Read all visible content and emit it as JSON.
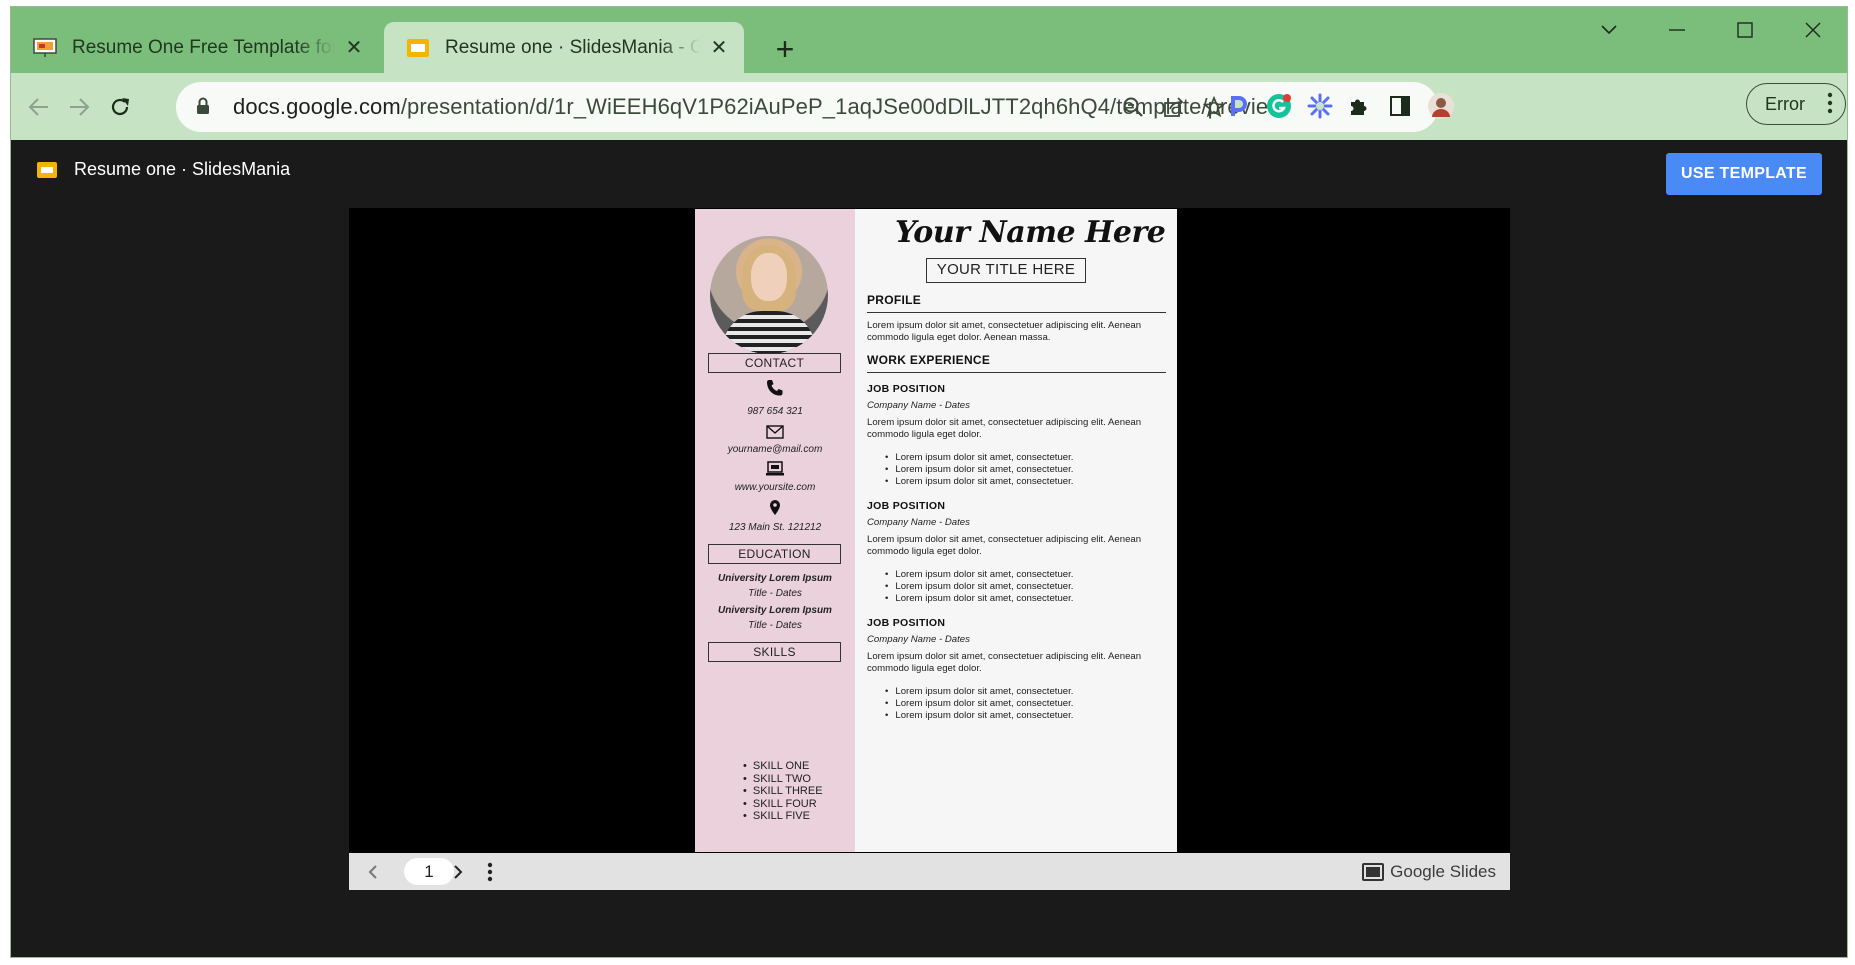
{
  "browser": {
    "tabs": [
      {
        "title": "Resume One Free Template for Google Slides",
        "active": false
      },
      {
        "title": "Resume one · SlidesMania - Google Slides",
        "active": true
      }
    ],
    "url_host": "docs.google.com",
    "url_path": "/presentation/d/1r_WiEEH6qV1P62iAuPeP_1aqJSe00dDlLJTT2qh6hQ4/template/preview",
    "profile_status": "Error"
  },
  "app": {
    "doc_title": "Resume one · SlidesMania",
    "use_template_label": "USE TEMPLATE",
    "current_page": "1",
    "footer_brand": "Google Slides"
  },
  "resume": {
    "name": "Your Name Here",
    "title": "YOUR TITLE HERE",
    "contact_header": "CONTACT",
    "phone": "987 654 321",
    "email": "yourname@mail.com",
    "website": "www.yoursite.com",
    "address": "123 Main St. 121212",
    "education_header": "EDUCATION",
    "education": [
      {
        "name": "University Lorem Ipsum",
        "title": "Title - Dates"
      },
      {
        "name": "University Lorem Ipsum",
        "title": "Title - Dates"
      }
    ],
    "skills_header": "SKILLS",
    "skills": [
      "SKILL ONE",
      "SKILL TWO",
      "SKILL THREE",
      "SKILL FOUR",
      "SKILL FIVE"
    ],
    "profile_header": "PROFILE",
    "profile_text": "Lorem ipsum dolor sit amet, consectetuer adipiscing elit. Aenean commodo ligula eget dolor. Aenean massa.",
    "work_header": "WORK EXPERIENCE",
    "jobs": [
      {
        "position": "JOB POSITION",
        "company": "Company Name - Dates",
        "desc": "Lorem ipsum dolor sit amet, consectetuer adipiscing elit. Aenean commodo ligula eget dolor.",
        "bullets": [
          "Lorem ipsum dolor sit amet, consectetuer.",
          "Lorem ipsum dolor sit amet, consectetuer.",
          "Lorem ipsum dolor sit amet, consectetuer."
        ]
      },
      {
        "position": "JOB POSITION",
        "company": "Company Name - Dates",
        "desc": "Lorem ipsum dolor sit amet, consectetuer adipiscing elit. Aenean commodo ligula eget dolor.",
        "bullets": [
          "Lorem ipsum dolor sit amet, consectetuer.",
          "Lorem ipsum dolor sit amet, consectetuer.",
          "Lorem ipsum dolor sit amet, consectetuer."
        ]
      },
      {
        "position": "JOB POSITION",
        "company": "Company Name - Dates",
        "desc": "Lorem ipsum dolor sit amet, consectetuer adipiscing elit. Aenean commodo ligula eget dolor.",
        "bullets": [
          "Lorem ipsum dolor sit amet, consectetuer.",
          "Lorem ipsum dolor sit amet, consectetuer.",
          "Lorem ipsum dolor sit amet, consectetuer."
        ]
      }
    ]
  },
  "icons": {
    "tab1_favicon": "slides-presentation-icon",
    "tab2_favicon": "google-slides-icon",
    "phone": "phone-icon",
    "email": "envelope-icon",
    "website": "laptop-icon",
    "address": "map-pin-icon"
  },
  "colors": {
    "tabstrip": "#7bbd7b",
    "toolbar": "#c6e4c3",
    "accent_button": "#4a8af4",
    "resume_sidebar": "#ead1dc"
  }
}
